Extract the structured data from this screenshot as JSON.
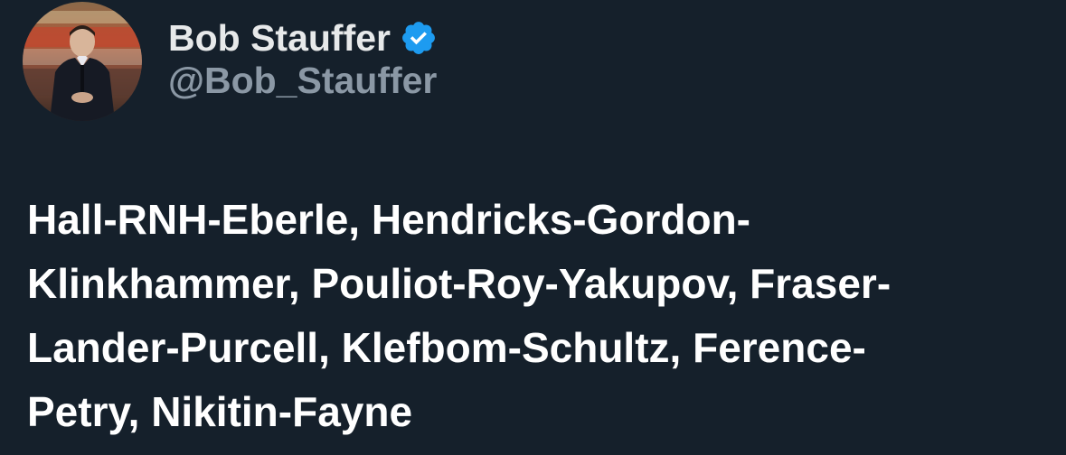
{
  "author": {
    "display_name": "Bob Stauffer",
    "handle": "@Bob_Stauffer",
    "verified": true,
    "avatar_icon": "profile-photo"
  },
  "tweet": {
    "text": "Hall-RNH-Eberle, Hendricks-Gordon-Klinkhammer, Pouliot-Roy-Yakupov, Fraser-Lander-Purcell, Klefbom-Schultz, Ference-Petry, Nikitin-Fayne",
    "lines": [
      "Hall-RNH-Eberle, Hendricks-Gordon-",
      "Klinkhammer, Pouliot-Roy-Yakupov, Fraser-",
      "Lander-Purcell, Klefbom-Schultz, Ference-",
      "Petry, Nikitin-Fayne"
    ]
  },
  "colors": {
    "background": "#15202b",
    "text": "#ffffff",
    "handle": "#8b98a5",
    "verified_badge": "#1d9bf0"
  }
}
